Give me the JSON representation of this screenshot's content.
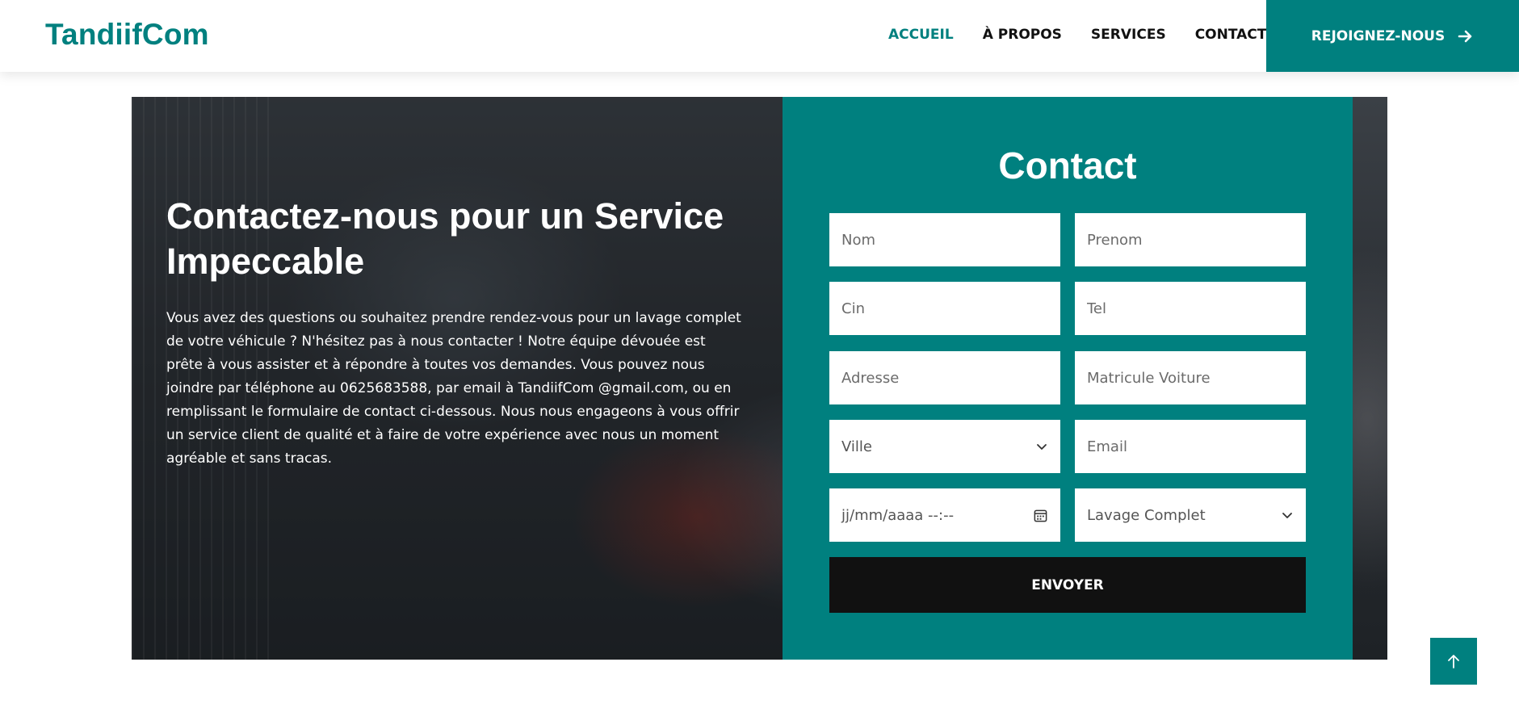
{
  "brand": {
    "name": "TandiifCom"
  },
  "nav": {
    "items": [
      {
        "label": "ACCUEIL",
        "active": true
      },
      {
        "label": "À PROPOS",
        "active": false
      },
      {
        "label": "SERVICES",
        "active": false
      },
      {
        "label": "CONTACT",
        "active": false
      }
    ],
    "cta_label": "REJOIGNEZ-NOUS",
    "cta_icon": "arrow-right-icon"
  },
  "hero": {
    "title": "Contactez-nous pour un Service Impeccable",
    "text": "Vous avez des questions ou souhaitez prendre rendez-vous pour un lavage complet de votre véhicule ? N'hésitez pas à nous contacter ! Notre équipe dévouée est prête à vous assister et à répondre à toutes vos demandes. Vous pouvez nous joindre par téléphone au 0625683588, par email à TandiifCom @gmail.com, ou en remplissant le formulaire de contact ci-dessous. Nous nous engageons à vous offrir un service client de qualité et à faire de votre expérience avec nous un moment agréable et sans tracas."
  },
  "contact": {
    "title": "Contact",
    "fields": {
      "nom": {
        "placeholder": "Nom"
      },
      "prenom": {
        "placeholder": "Prenom"
      },
      "cin": {
        "placeholder": "Cin"
      },
      "tel": {
        "placeholder": "Tel"
      },
      "adresse": {
        "placeholder": "Adresse"
      },
      "matricule": {
        "placeholder": "Matricule Voiture"
      },
      "ville": {
        "selected": "Ville"
      },
      "email": {
        "placeholder": "Email"
      },
      "datetime": {
        "placeholder": "jj/mm/aaaa --:--"
      },
      "service": {
        "selected": "Lavage Complet"
      }
    },
    "submit_label": "ENVOYER"
  },
  "colors": {
    "accent": "#00807f",
    "dark": "#111111",
    "white": "#ffffff"
  },
  "back_to_top": {
    "icon": "arrow-up-icon"
  }
}
